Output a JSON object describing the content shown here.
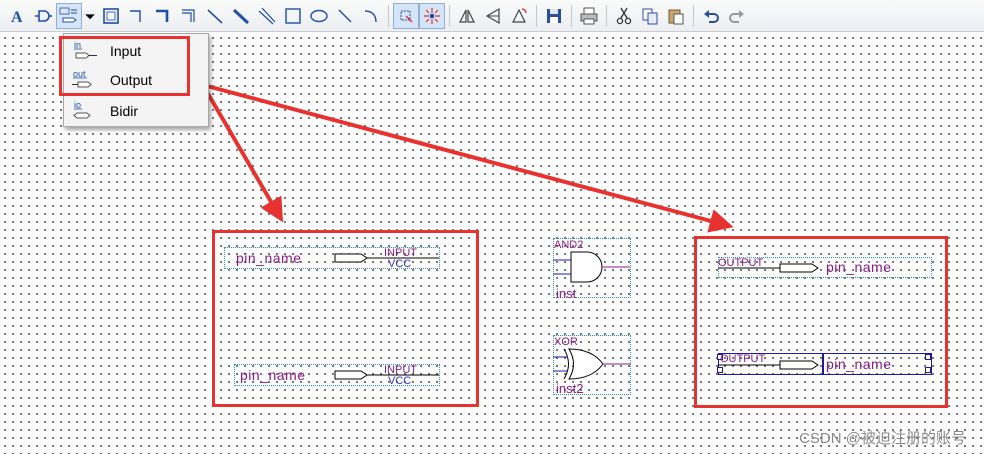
{
  "toolbar": {
    "buttons": [
      {
        "icon": "text-tool-icon"
      },
      {
        "icon": "symbol-tool-icon"
      },
      {
        "icon": "pin-tool-icon"
      },
      {
        "icon": "dropdown-arrow-icon"
      },
      {
        "icon": "block-tool-icon"
      },
      {
        "icon": "orthogonal-node-tool-icon"
      },
      {
        "icon": "orthogonal-bus-tool-icon"
      },
      {
        "icon": "orthogonal-conduit-tool-icon"
      },
      {
        "icon": "node-tool-icon"
      },
      {
        "icon": "bus-tool-icon"
      },
      {
        "icon": "conduit-tool-icon"
      },
      {
        "icon": "rectangle-tool-icon"
      },
      {
        "icon": "oval-tool-icon"
      },
      {
        "icon": "line-tool-icon"
      },
      {
        "icon": "arc-tool-icon"
      },
      {
        "icon": "rubberbanding-icon"
      },
      {
        "icon": "partial-line-select-icon"
      },
      {
        "icon": "flip-horizontal-icon"
      },
      {
        "icon": "flip-vertical-icon"
      },
      {
        "icon": "rotate-left-icon"
      },
      {
        "icon": "save-icon"
      },
      {
        "icon": "print-icon"
      },
      {
        "icon": "cut-icon"
      },
      {
        "icon": "copy-icon"
      },
      {
        "icon": "paste-icon"
      },
      {
        "icon": "undo-icon"
      },
      {
        "icon": "redo-icon"
      }
    ]
  },
  "menu": {
    "items": [
      {
        "label": "Input",
        "icon_text": "in"
      },
      {
        "label": "Output",
        "icon_text": "out"
      },
      {
        "label": "Bidir",
        "icon_text": "io"
      }
    ]
  },
  "schematic": {
    "input_pins": [
      {
        "name": "pin_name",
        "type": "INPUT",
        "vcc": "VCC"
      },
      {
        "name": "pin_name",
        "type": "INPUT",
        "vcc": "VCC"
      }
    ],
    "gates": [
      {
        "type": "AND2",
        "inst": "inst"
      },
      {
        "type": "XOR",
        "inst": "inst2"
      }
    ],
    "output_pins": [
      {
        "name": "pin_name",
        "type": "OUTPUT"
      },
      {
        "name": "pin_name",
        "type": "OUTPUT"
      }
    ]
  },
  "colors": {
    "highlight": "#e8322f",
    "label": "#8a1a88",
    "vcc": "#3333cc",
    "selection": "#1a1aa0"
  },
  "watermark": "CSDN @被迫注册的账号"
}
